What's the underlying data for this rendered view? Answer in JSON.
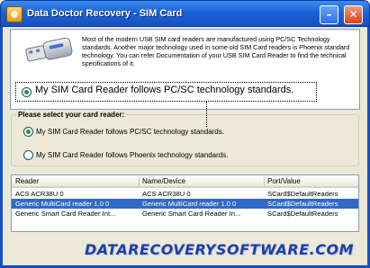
{
  "window": {
    "title": "Data Doctor Recovery - SIM Card",
    "min_label": "–",
    "close_label": "✕"
  },
  "info": {
    "text": "Most of the modern USB SIM card readers are manufactured using PC/SC Technology standards. Another major technology used in some old SIM Card readers is Phoenix standard technology. You can refer Documentation of your USB SIM Card Reader to find the technical specifications of it.",
    "icon": "usb-drive-icon"
  },
  "highlight_option": {
    "label": "My SIM Card Reader follows PC/SC technology standards."
  },
  "reader_group": {
    "title": "Please select your card reader:",
    "options": [
      {
        "label": "My SIM Card Reader follows PC/SC technology standards.",
        "checked": true
      },
      {
        "label": "My SIM Card Reader follows Phoenix technology standards.",
        "checked": false
      }
    ]
  },
  "table": {
    "columns": [
      "Reader",
      "Name/Device",
      "Port/Value"
    ],
    "rows": [
      {
        "reader": "ACS ACR38U 0",
        "device": "ACS ACR38U 0",
        "port": "SCard$DefaultReaders",
        "selected": false
      },
      {
        "reader": "Generic MultiCard reader 1.0 0",
        "device": "Generic MultiCard reader 1.0 0",
        "port": "SCard$DefaultReaders",
        "selected": true
      },
      {
        "reader": "Generic Smart Card Reader Int...",
        "device": "Generic Smart Card Reader In...",
        "port": "SCard$DefaultReaders",
        "selected": false
      }
    ]
  },
  "footer": {
    "site": "DATARECOVERYSOFTWARE.COM"
  },
  "colors": {
    "title_bar": "#1e63d8",
    "selection": "#316ac5",
    "site_text": "#1f3fa6"
  }
}
